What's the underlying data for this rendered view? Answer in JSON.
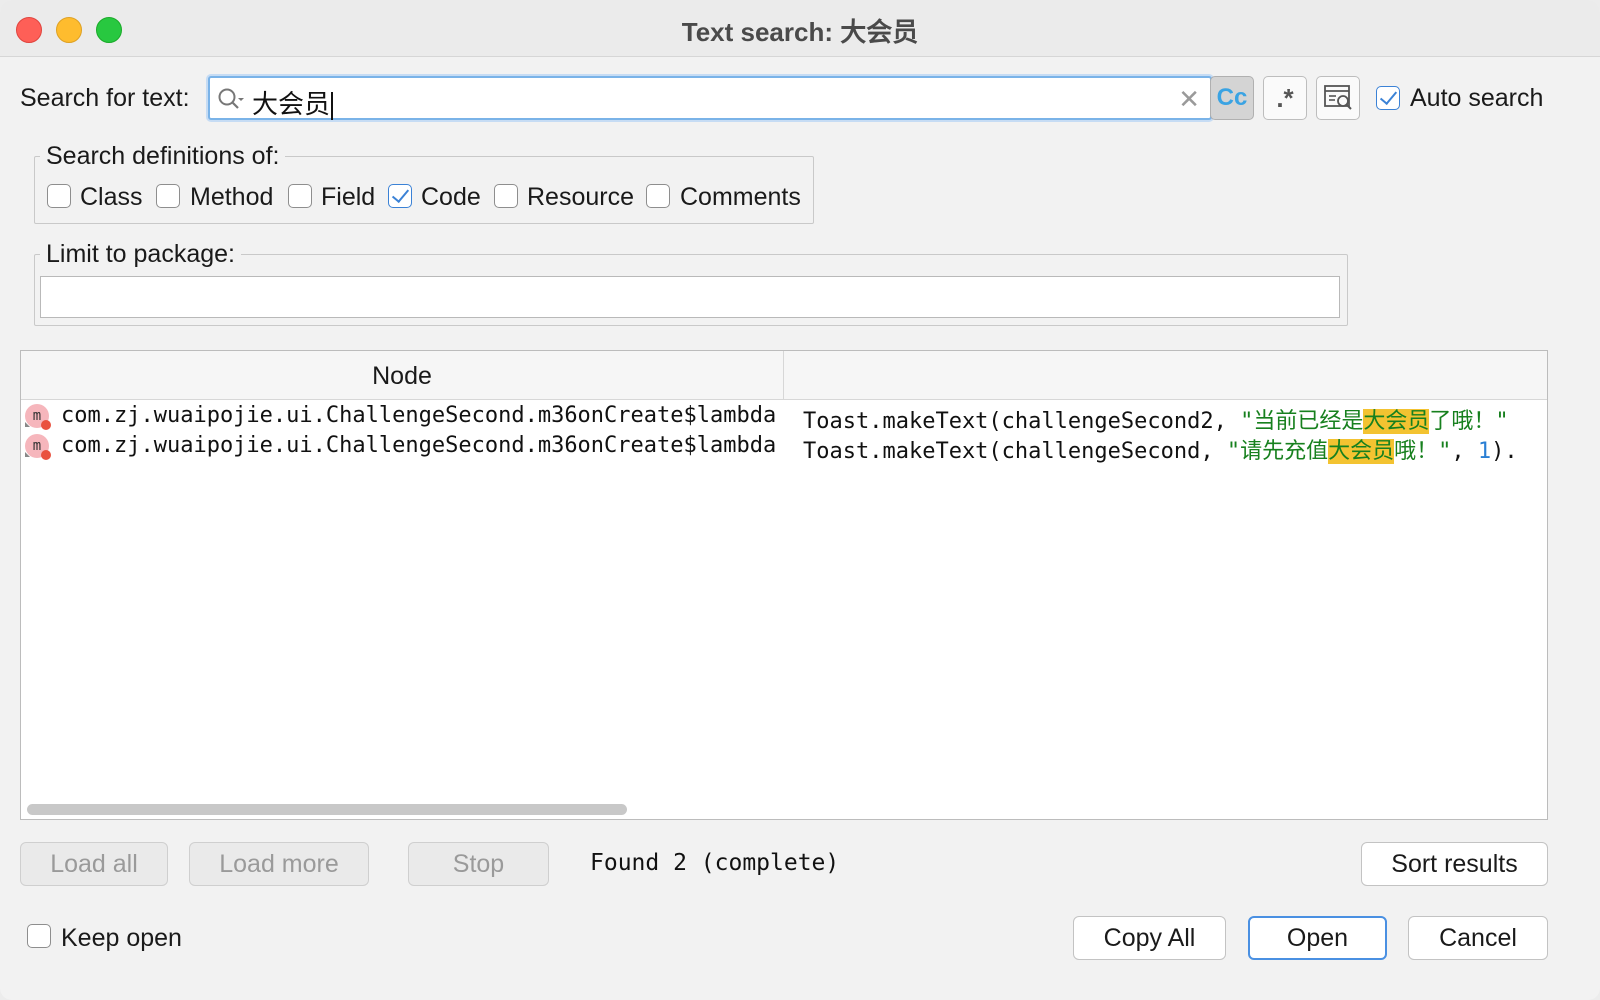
{
  "window": {
    "title": "Text search: 大会员"
  },
  "search": {
    "label": "Search for text:",
    "value": "大会员",
    "auto_search_label": "Auto search",
    "auto_search_checked": true,
    "case_sensitive_label": "Cc",
    "regex_label": ".*"
  },
  "definitions": {
    "title": "Search definitions of:",
    "options": [
      {
        "label": "Class",
        "checked": false
      },
      {
        "label": "Method",
        "checked": false
      },
      {
        "label": "Field",
        "checked": false
      },
      {
        "label": "Code",
        "checked": true
      },
      {
        "label": "Resource",
        "checked": false
      },
      {
        "label": "Comments",
        "checked": false
      }
    ]
  },
  "package": {
    "title": "Limit to package:",
    "value": ""
  },
  "results": {
    "columns": [
      "Node",
      ""
    ],
    "rows": [
      {
        "icon": "method-icon",
        "node": "com.zj.wuaipojie.ui.ChallengeSecond.m36onCreate$lambda",
        "code_prefix": "Toast.makeText(challengeSecond2, ",
        "str_before": "\"当前已经是",
        "match": "大会员",
        "str_after": "了哦！\"",
        "code_suffix": ""
      },
      {
        "icon": "method-icon",
        "node": "com.zj.wuaipojie.ui.ChallengeSecond.m36onCreate$lambda",
        "code_prefix": "Toast.makeText(challengeSecond, ",
        "str_before": "\"请先充值",
        "match": "大会员",
        "str_after": "哦！\"",
        "code_suffix": ", ",
        "num": "1",
        "code_end": ")."
      }
    ]
  },
  "footer": {
    "load_all": "Load all",
    "load_more": "Load more",
    "stop": "Stop",
    "status": "Found 2 (complete)",
    "sort_results": "Sort results",
    "keep_open": "Keep open",
    "keep_open_checked": false,
    "copy_all": "Copy All",
    "open": "Open",
    "cancel": "Cancel"
  },
  "colors": {
    "accent": "#3b82d6",
    "highlight": "#f3c331",
    "string": "#17801e"
  }
}
